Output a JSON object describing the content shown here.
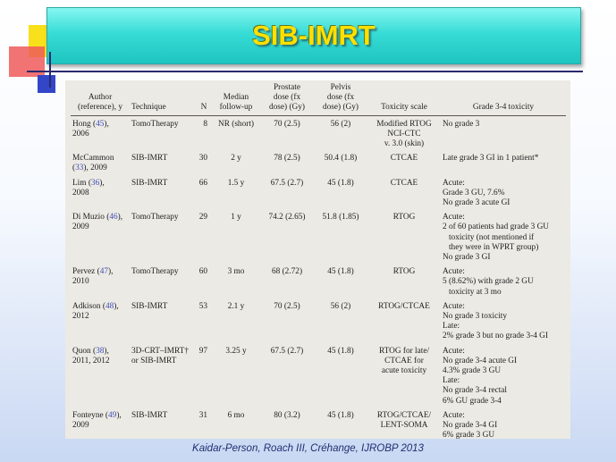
{
  "slide": {
    "title": "SIB-IMRT",
    "citation": "Kaidar-Person, Roach III, Créhange, IJROBP 2013"
  },
  "table": {
    "headers": [
      [
        "Author",
        "(reference), y"
      ],
      [
        "Technique"
      ],
      [
        "N"
      ],
      [
        "Median",
        "follow-up"
      ],
      [
        "Prostate",
        "dose (fx",
        "dose) (Gy)"
      ],
      [
        "Pelvis",
        "dose (fx",
        "dose) (Gy)"
      ],
      [
        "Toxicity scale"
      ],
      [
        "Grade 3-4 toxicity"
      ]
    ],
    "rows": [
      {
        "author": [
          "Hong (",
          "45",
          "),"
        ],
        "year": "2006",
        "technique": [
          "TomoTherapy"
        ],
        "n": "8",
        "followup": "NR (short)",
        "prostate": "70 (2.5)",
        "pelvis": "56 (2)",
        "scale": [
          "Modified RTOG",
          "NCI-CTC",
          "v. 3.0 (skin)"
        ],
        "toxicity": [
          "No grade 3"
        ]
      },
      {
        "author": [
          "McCammon",
          "(",
          "33",
          "), 2009"
        ],
        "year": "",
        "technique": [
          "SIB-IMRT"
        ],
        "n": "30",
        "followup": "2 y",
        "prostate": "78 (2.5)",
        "pelvis": "50.4 (1.8)",
        "scale": [
          "CTCAE"
        ],
        "toxicity": [
          "Late grade 3 GI in 1 patient*"
        ]
      },
      {
        "author": [
          "Lim (",
          "36",
          "),"
        ],
        "year": "2008",
        "technique": [
          "SIB-IMRT"
        ],
        "n": "66",
        "followup": "1.5 y",
        "prostate": "67.5 (2.7)",
        "pelvis": "45 (1.8)",
        "scale": [
          "CTCAE"
        ],
        "toxicity": [
          "Acute:",
          "Grade 3 GU, 7.6%",
          "No grade 3 acute GI"
        ]
      },
      {
        "author": [
          "Di Muzio (",
          "46",
          "),"
        ],
        "year": "2009",
        "technique": [
          "TomoTherapy"
        ],
        "n": "29",
        "followup": "1 y",
        "prostate": "74.2 (2.65)",
        "pelvis": "51.8 (1.85)",
        "scale": [
          "RTOG"
        ],
        "toxicity": [
          "Acute:",
          "2 of 60 patients had grade 3 GU",
          "   toxicity (not mentioned if",
          "   they were in WPRT group)",
          "No grade 3 GI"
        ]
      },
      {
        "author": [
          "Pervez (",
          "47",
          "),"
        ],
        "year": "2010",
        "technique": [
          "TomoTherapy"
        ],
        "n": "60",
        "followup": "3 mo",
        "prostate": "68 (2.72)",
        "pelvis": "45 (1.8)",
        "scale": [
          "RTOG"
        ],
        "toxicity": [
          "Acute:",
          "5 (8.62%) with grade 2 GU",
          "   toxicity at 3 mo"
        ]
      },
      {
        "author": [
          "Adkison (",
          "48",
          "),"
        ],
        "year": "2012",
        "technique": [
          "SIB-IMRT"
        ],
        "n": "53",
        "followup": "2.1 y",
        "prostate": "70 (2.5)",
        "pelvis": "56 (2)",
        "scale": [
          "RTOG/CTCAE"
        ],
        "toxicity": [
          "Acute:",
          "No grade 3 toxicity",
          "Late:",
          "2% grade 3 but no grade 3-4 GI"
        ]
      },
      {
        "author": [
          "Quon (",
          "38",
          "),"
        ],
        "year": "2011, 2012",
        "technique": [
          "3D-CRT–IMRT†",
          "or SIB-IMRT"
        ],
        "n": "97",
        "followup": "3.25 y",
        "prostate": "67.5 (2.7)",
        "pelvis": "45 (1.8)",
        "scale": [
          "RTOG for late/",
          "CTCAE for",
          "acute toxicity"
        ],
        "toxicity": [
          "Acute:",
          "No grade 3-4 acute GI",
          "4.3% grade 3 GU",
          "Late:",
          "No grade 3-4 rectal",
          "6% GU grade 3-4"
        ]
      },
      {
        "author": [
          "Fonteyne (",
          "49",
          "),"
        ],
        "year": "2009",
        "technique": [
          "SIB-IMRT"
        ],
        "n": "31",
        "followup": "6 mo",
        "prostate": "80 (3.2)",
        "pelvis": "45 (1.8)",
        "scale": [
          "RTOG/CTCAE/",
          "LENT-SOMA"
        ],
        "toxicity": [
          "Acute:",
          "No grade 3-4 GI",
          "6% grade 3 GU"
        ]
      }
    ]
  }
}
